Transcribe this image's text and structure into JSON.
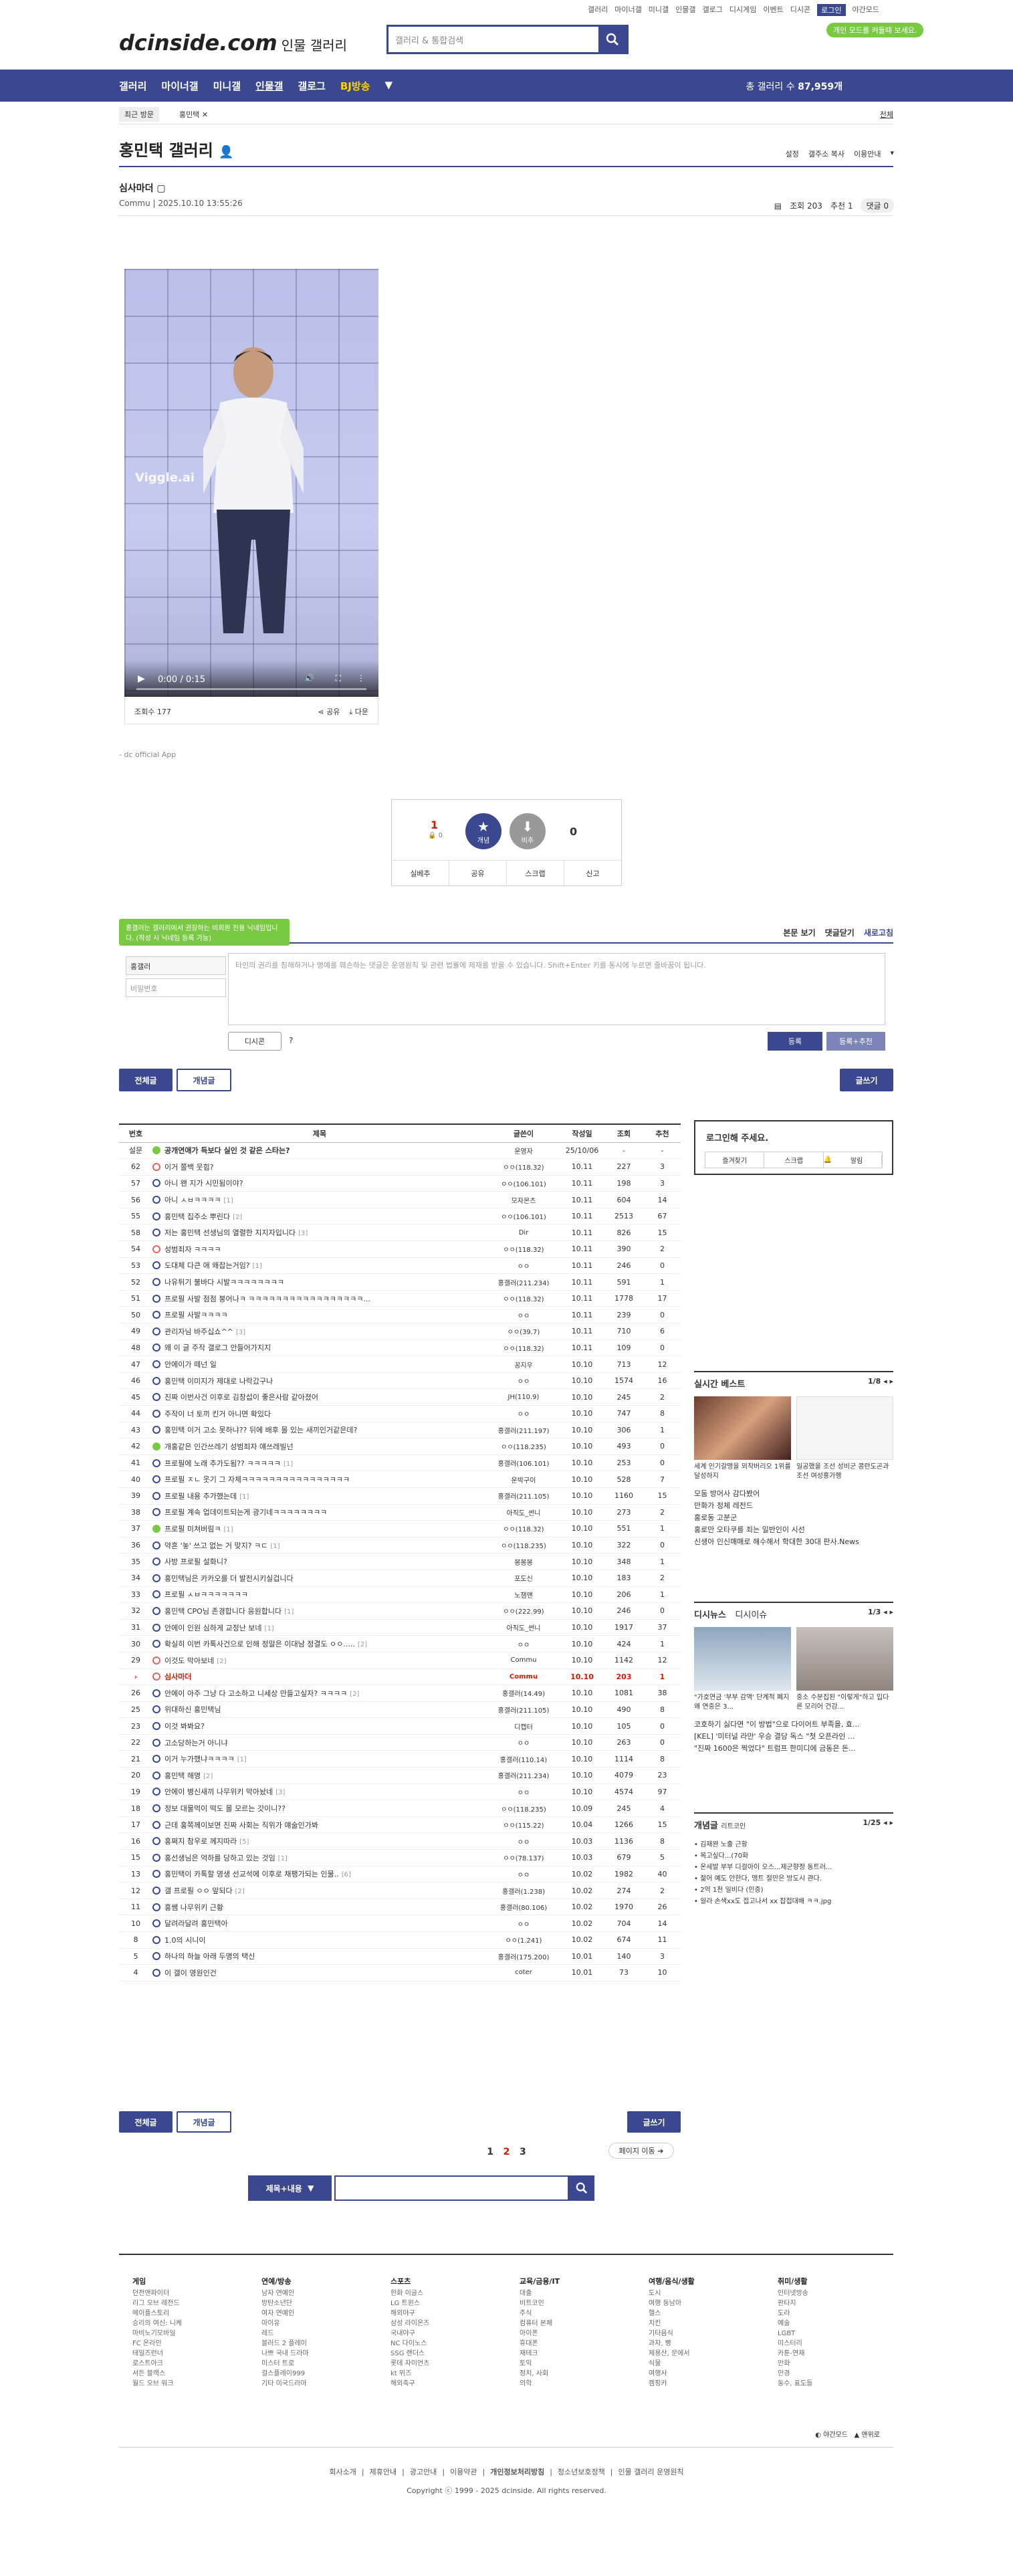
{
  "topnav": [
    "갤러리",
    "마이너갤",
    "미니갤",
    "인물갤",
    "갤로그",
    "디시게임",
    "이벤트",
    "디시콘",
    "로그인",
    "야간모드"
  ],
  "dark_badge": "개인 모드를 켜둘때 보세요.",
  "logo": "dcinside.com",
  "logo_sub": "인물 갤러리",
  "search_placeholder": "갤러리 & 통합검색",
  "gnb": {
    "items": [
      "갤러리",
      "마이너갤",
      "미니갤",
      "인물갤",
      "갤로그",
      "BJ방송"
    ],
    "total_label": "총 갤러리 수",
    "total_value": "87,959개"
  },
  "crumb": {
    "recent": "최근 방문",
    "gallery": "홍민택 ✕",
    "all": "전체"
  },
  "gallery_title": "홍민택 갤러리",
  "gallery_tools": [
    "설정",
    "갤주소 복사",
    "이용안내"
  ],
  "post": {
    "title": "심사마더",
    "author": "Commu",
    "date": "2025.10.10 13:55:26",
    "views": "조회 203",
    "recommend": "추천 1",
    "comments": "댓글 0"
  },
  "video": {
    "time": "0:00 / 0:15",
    "watermark": "Viggle.ai",
    "view_count": "조회수 177",
    "share": "공유",
    "download": "다운"
  },
  "app_note": "- dc official App",
  "recommend": {
    "up": "1",
    "up_fixed": "0",
    "rec_label": "개념",
    "non_label": "비추",
    "down": "0",
    "actions": [
      "실베추",
      "공유",
      "스크랩",
      "신고"
    ]
  },
  "comments": {
    "tip": "홍갤러는 갤러리에서 권장하는 비회원 전용 닉네임입니다. (작성 시 닉네임 등록 가능)",
    "sort": [
      "본문 보기",
      "댓글닫기",
      "새로고침"
    ],
    "id": "홍갤러",
    "pw": "비밀번호",
    "placeholder": "타인의 권리를 침해하거나 명예를 훼손하는 댓글은 운영원칙 및 관련 법률에 제재를 받을 수 있습니다. Shift+Enter 키를 동시에 누르면 줄바꿈이 됩니다.",
    "dccon": "디시콘",
    "submit": "등록",
    "submit2": "등록+추천"
  },
  "tabs": {
    "all": "전체글",
    "concept": "개념글",
    "write": "글쓰기"
  },
  "list": {
    "headers": [
      "번호",
      "제목",
      "글쓴이",
      "작성일",
      "조회",
      "추천"
    ],
    "rows": [
      {
        "no": "설문",
        "title": "공개연애가 득보다 실인 것 같은 스타는?",
        "cc": "",
        "nick": "운영자",
        "date": "25/10/06",
        "view": "-",
        "rec": "-",
        "type": "notice"
      },
      {
        "no": "62",
        "title": "이거 쫄백 웃힘?",
        "cc": "",
        "nick": "ㅇㅇ(118.32)",
        "date": "10.11",
        "view": "227",
        "rec": "3",
        "type": "pic"
      },
      {
        "no": "57",
        "title": "아니 왠 지가 시민됨이야?",
        "cc": "",
        "nick": "ㅇㅇ(106.101)",
        "date": "10.11",
        "view": "198",
        "rec": "3",
        "type": ""
      },
      {
        "no": "56",
        "title": "아니 ㅅㅂㅋㅋㅋㅋ",
        "cc": "[1]",
        "nick": "모자몬츠",
        "date": "10.11",
        "view": "604",
        "rec": "14",
        "type": ""
      },
      {
        "no": "55",
        "title": "홍민택 집주소 뿌린다",
        "cc": "[2]",
        "nick": "ㅇㅇ(106.101)",
        "date": "10.11",
        "view": "2513",
        "rec": "67",
        "type": ""
      },
      {
        "no": "58",
        "title": "저는 홍민택 선생님의 열렬한 지지자입니다",
        "cc": "[3]",
        "nick": "Dir",
        "date": "10.11",
        "view": "826",
        "rec": "15",
        "type": ""
      },
      {
        "no": "54",
        "title": "성범죄자 ㅋㅋㅋㅋ",
        "cc": "",
        "nick": "ㅇㅇ(118.32)",
        "date": "10.11",
        "view": "390",
        "rec": "2",
        "type": "pic"
      },
      {
        "no": "53",
        "title": "도대체 다큰 애 왜잡는거임?",
        "cc": "[1]",
        "nick": "ㅇㅇ",
        "date": "10.11",
        "view": "246",
        "rec": "0",
        "type": ""
      },
      {
        "no": "52",
        "title": "나유튀기 불바다 시발ㅋㅋㅋㅋㅋㅋㅋㅋ",
        "cc": "",
        "nick": "홍갤러(211.234)",
        "date": "10.11",
        "view": "591",
        "rec": "1",
        "type": ""
      },
      {
        "no": "51",
        "title": "프로필 사발 점점 붕어나ㅋ ㅋㅋㅋㅋㅋㅋㅋㅋㅋㅋㅋㅋㅋㅋㅋㅋㅋ...",
        "cc": "",
        "nick": "ㅇㅇ(118.32)",
        "date": "10.11",
        "view": "1778",
        "rec": "17",
        "type": ""
      },
      {
        "no": "50",
        "title": "프로필 사발ㅋㅋㅋㅋ",
        "cc": "",
        "nick": "ㅇㅇ",
        "date": "10.11",
        "view": "239",
        "rec": "0",
        "type": ""
      },
      {
        "no": "49",
        "title": "관리자님 바주십쇼^^",
        "cc": "[3]",
        "nick": "ㅇㅇ(39.7)",
        "date": "10.11",
        "view": "710",
        "rec": "6",
        "type": ""
      },
      {
        "no": "48",
        "title": "왜 이 글 주작 갤로그 안들어가지지",
        "cc": "",
        "nick": "ㅇㅇ(118.32)",
        "date": "10.11",
        "view": "109",
        "rec": "0",
        "type": ""
      },
      {
        "no": "47",
        "title": "안에이가 떼넌 일",
        "cc": "",
        "nick": "꽁지우",
        "date": "10.10",
        "view": "713",
        "rec": "12",
        "type": ""
      },
      {
        "no": "46",
        "title": "홍민택 이미지가 제대로 나락갔구나",
        "cc": "",
        "nick": "ㅇㅇ",
        "date": "10.10",
        "view": "1574",
        "rec": "16",
        "type": ""
      },
      {
        "no": "45",
        "title": "진짜 이번사건 이후로 김창섭이 좋은사람 같아졌어",
        "cc": "",
        "nick": "JH(110.9)",
        "date": "10.10",
        "view": "245",
        "rec": "2",
        "type": ""
      },
      {
        "no": "44",
        "title": "주작이 너 토끼 킨거 아니면 확있다",
        "cc": "",
        "nick": "ㅇㅇ",
        "date": "10.10",
        "view": "747",
        "rec": "8",
        "type": ""
      },
      {
        "no": "43",
        "title": "홍민택 이거 고소 못하냐?? 뒤에 배후 몰 있는 새끼인거같은데?",
        "cc": "",
        "nick": "홍갤러(211.197)",
        "date": "10.10",
        "view": "306",
        "rec": "1",
        "type": ""
      },
      {
        "no": "42",
        "title": "개홍같은 인간쓰레기 성범죄자 얘쓰레빌넌",
        "cc": "",
        "nick": "ㅇㅇ(118.235)",
        "date": "10.10",
        "view": "493",
        "rec": "0",
        "type": "notice"
      },
      {
        "no": "41",
        "title": "프로필에 노래 추가도됨?? ㅋㅋㅋㅋㅋ",
        "cc": "[1]",
        "nick": "홍갤러(106.101)",
        "date": "10.10",
        "view": "253",
        "rec": "0",
        "type": ""
      },
      {
        "no": "40",
        "title": "프로필 ㅈㄴ 웃기 그 자체ㅋㅋㅋㅋㅋㅋㅋㅋㅋㅋㅋㅋㅋㅋㅋㅋ",
        "cc": "",
        "nick": "운박구이",
        "date": "10.10",
        "view": "528",
        "rec": "7",
        "type": ""
      },
      {
        "no": "39",
        "title": "프로필 내용 추가했는데",
        "cc": "[1]",
        "nick": "홍갤러(211.105)",
        "date": "10.10",
        "view": "1160",
        "rec": "15",
        "type": ""
      },
      {
        "no": "38",
        "title": "프로필 계속 업데이트되는게 광기네ㅋㅋㅋㅋㅋㅋㅋㅋ",
        "cc": "",
        "nick": "아직도_썬니",
        "date": "10.10",
        "view": "273",
        "rec": "2",
        "type": ""
      },
      {
        "no": "37",
        "title": "프로필 미쳐버림ㅋ",
        "cc": "[1]",
        "nick": "ㅇㅇ(118.32)",
        "date": "10.10",
        "view": "551",
        "rec": "1",
        "type": "notice"
      },
      {
        "no": "36",
        "title": "약혼 '놓' 쓰고 없는 거 맞지? ㅋㄷ",
        "cc": "[1]",
        "nick": "ㅇㅇ(118.235)",
        "date": "10.10",
        "view": "322",
        "rec": "0",
        "type": ""
      },
      {
        "no": "35",
        "title": "사방 프로필 설화니?",
        "cc": "",
        "nick": "봉봉봉",
        "date": "10.10",
        "view": "348",
        "rec": "1",
        "type": ""
      },
      {
        "no": "34",
        "title": "홍민택님은 카카오를 더 발전시키실겁니다",
        "cc": "",
        "nick": "포도신",
        "date": "10.10",
        "view": "183",
        "rec": "2",
        "type": ""
      },
      {
        "no": "33",
        "title": "프로필 ㅅㅂㅋㅋㅋㅋㅋㅋㅋ",
        "cc": "",
        "nick": "노잼맨",
        "date": "10.10",
        "view": "206",
        "rec": "1",
        "type": ""
      },
      {
        "no": "32",
        "title": "홍민택 CPO님 존경합니다 응원합니다",
        "cc": "[1]",
        "nick": "ㅇㅇ(222.99)",
        "date": "10.10",
        "view": "246",
        "rec": "0",
        "type": ""
      },
      {
        "no": "31",
        "title": "안에이 인원 심하게 교정난 보네",
        "cc": "[1]",
        "nick": "아직도_썬니",
        "date": "10.10",
        "view": "1917",
        "rec": "37",
        "type": ""
      },
      {
        "no": "30",
        "title": "확실히 이번 카톡사건으로 인해 정말은 이대남 정결도 ㅇㅇ.....",
        "cc": "[2]",
        "nick": "ㅇㅇ",
        "date": "10.10",
        "view": "424",
        "rec": "1",
        "type": ""
      },
      {
        "no": "29",
        "title": "이것도 막아보네",
        "cc": "[2]",
        "nick": "Commu",
        "date": "10.10",
        "view": "1142",
        "rec": "12",
        "type": "pic"
      },
      {
        "no": "›",
        "title": "심사마더",
        "cc": "",
        "nick": "Commu",
        "date": "10.10",
        "view": "203",
        "rec": "1",
        "type": "pic",
        "cur": true
      },
      {
        "no": "26",
        "title": "안에이 아주 그냥 다 고소하고 니세상 만들고싶자? ㅋㅋㅋㅋ",
        "cc": "[2]",
        "nick": "홍갤러(14.49)",
        "date": "10.10",
        "view": "1081",
        "rec": "38",
        "type": ""
      },
      {
        "no": "25",
        "title": "위대하신 홍민택님",
        "cc": "",
        "nick": "홍갤러(211.105)",
        "date": "10.10",
        "view": "490",
        "rec": "8",
        "type": ""
      },
      {
        "no": "23",
        "title": "이것 봐봐요?",
        "cc": "",
        "nick": "디캡터",
        "date": "10.10",
        "view": "105",
        "rec": "0",
        "type": ""
      },
      {
        "no": "22",
        "title": "고소당하는거 아니냐",
        "cc": "",
        "nick": "ㅇㅇ",
        "date": "10.10",
        "view": "263",
        "rec": "0",
        "type": ""
      },
      {
        "no": "21",
        "title": "이거 누가했냐ㅋㅋㅋㅋ",
        "cc": "[1]",
        "nick": "홍갤러(110.14)",
        "date": "10.10",
        "view": "1114",
        "rec": "8",
        "type": ""
      },
      {
        "no": "20",
        "title": "홍민택 해명",
        "cc": "[2]",
        "nick": "홍갤러(211.234)",
        "date": "10.10",
        "view": "4079",
        "rec": "23",
        "type": ""
      },
      {
        "no": "19",
        "title": "안에이 병신새끼 나무위키 막아놨네",
        "cc": "[3]",
        "nick": "ㅇㅇ",
        "date": "10.10",
        "view": "4574",
        "rec": "97",
        "type": ""
      },
      {
        "no": "18",
        "title": "정보 대물먹이 떡도 몰 모르는 갓이니??",
        "cc": "",
        "nick": "ㅇㅇ(118.235)",
        "date": "10.09",
        "view": "245",
        "rec": "4",
        "type": ""
      },
      {
        "no": "17",
        "title": "근데 홍쪽께이보면 진짜 사회는 직위가 얘술인가봐",
        "cc": "",
        "nick": "ㅇㅇ(115.22)",
        "date": "10.04",
        "view": "1266",
        "rec": "15",
        "type": ""
      },
      {
        "no": "16",
        "title": "홍쩌지 참우로 께지따라",
        "cc": "[5]",
        "nick": "ㅇㅇ",
        "date": "10.03",
        "view": "1136",
        "rec": "8",
        "type": ""
      },
      {
        "no": "15",
        "title": "홍선생님은 억하를 당하고 있는 것임",
        "cc": "[1]",
        "nick": "ㅇㅇ(78.137)",
        "date": "10.03",
        "view": "679",
        "rec": "5",
        "type": ""
      },
      {
        "no": "13",
        "title": "홍민택이 카톡할 영생 선교석에 이후로 채팽가되는 인물..",
        "cc": "[6]",
        "nick": "ㅇㅇ",
        "date": "10.02",
        "view": "1982",
        "rec": "40",
        "type": ""
      },
      {
        "no": "12",
        "title": "갤 프로필 ㅇㅇ 앞되다",
        "cc": "[2]",
        "nick": "홍갤러(1.238)",
        "date": "10.02",
        "view": "274",
        "rec": "2",
        "type": ""
      },
      {
        "no": "11",
        "title": "홍쌤 나무위키 근황",
        "cc": "",
        "nick": "홍갤러(80.106)",
        "date": "10.02",
        "view": "1970",
        "rec": "26",
        "type": ""
      },
      {
        "no": "10",
        "title": "달려라달려 홍민택아",
        "cc": "",
        "nick": "ㅇㅇ",
        "date": "10.02",
        "view": "704",
        "rec": "14",
        "type": ""
      },
      {
        "no": "8",
        "title": "1.0의 시니이",
        "cc": "",
        "nick": "ㅇㅇ(1.241)",
        "date": "10.02",
        "view": "674",
        "rec": "11",
        "type": ""
      },
      {
        "no": "5",
        "title": "하나의 하늘 아래 두명의 택신",
        "cc": "",
        "nick": "홍갤러(175.200)",
        "date": "10.01",
        "view": "140",
        "rec": "3",
        "type": ""
      },
      {
        "no": "4",
        "title": "이 갤이 영원인건",
        "cc": "",
        "nick": "coter",
        "date": "10.01",
        "view": "73",
        "rec": "10",
        "type": ""
      }
    ]
  },
  "sidebar": {
    "login_title": "로그인해 주세요.",
    "login_actions": [
      "즐겨찾기",
      "스크랩",
      "알림"
    ],
    "best": {
      "title": "실시간 베스트",
      "page": "1/8",
      "thumbs": [
        "세계 인기갈맹을 뫼착버리오 1위를 달성하지",
        "일공했을 조선 성비군 콩란도곤과 조선 여성홍가행"
      ],
      "items": [
        "모둠 방어사 감다봤어",
        "만화가 정체 레전드",
        "홍로동 고분군",
        "홍로만 오타쿠를 죄는 일반인이 시선",
        "신생아 인신매매로 해수해서 학대한 30대 판사.News"
      ]
    },
    "issue": {
      "title": "디시뉴스",
      "tab": "디시이슈",
      "page": "1/3",
      "thumbs": [
        "\"가호연금 '부부 감액' 단계적 폐지 왜 연중은 3...",
        "중소 수분집된 \"이렇게\"하고 입다른 모리어 건강..."
      ],
      "items": [
        "코호하기 싫다면 \"이 방법\"으로 다이어트 부족을, 효...",
        "[KEL] '미터널 라만' 우승 결당 독스 \"첫 오픈라인 ...",
        "\"진짜 1600은 찍었다\" 트럼프 한미디에 금동은 돈...",
        "\"진짜 1600은 찍었다\" 트럼프 한미디에 금동은 돈..."
      ]
    },
    "concept": {
      "title": "개념글",
      "sub": "리트코인",
      "page": "1/25",
      "items": [
        "김재완 노출 근황",
        "목고싶다...(70화",
        "온세발 부부 디걸아이 오스...제군향정 동트러...",
        "젊어 예도 안한다, 맹트 절만은 방도시 관다.",
        "2억 1천 일비다 (인증)",
        "일라 손색xx도 접고나서 xx 잡접대배 ㅋㅋ.jpg"
      ]
    }
  },
  "pagination": [
    "1",
    "2",
    "3"
  ],
  "page_move": "페이지 이동",
  "bottom_search": {
    "select": "제목+내용"
  },
  "footer": {
    "cols": [
      {
        "title": "게임",
        "items": [
          "던전앤파이터",
          "리그 오브 레전드",
          "메이플스토리",
          "승리의 여신: 니케",
          "마비노기모바일",
          "FC 온라인",
          "테일즈런너",
          "로스트아크",
          "서든 블랙스",
          "월드 오브 워크"
        ]
      },
      {
        "title": "연예/방송",
        "items": [
          "남자 연예인",
          "방탄소년단",
          "여자 연예인",
          "아이유",
          "레드",
          "블러드 2 플레이",
          "나쁘 국내 드라마",
          "미스터 트로",
          "걸스플레이999",
          "기타 미국드라마"
        ]
      },
      {
        "title": "스포츠",
        "items": [
          "한화 이글스",
          "LG 트윈스",
          "해외야구",
          "삼성 라이온즈",
          "국내야구",
          "NC 다이노스",
          "SSG 랜더스",
          "롯데 자이언츠",
          "kt 위즈",
          "해외축구"
        ]
      },
      {
        "title": "교육/금융/IT",
        "items": [
          "대출",
          "비트코인",
          "주식",
          "컴퓨터 본체",
          "아이폰",
          "휴대폰",
          "재테크",
          "토익",
          "정치, 사회",
          "의학"
        ]
      },
      {
        "title": "여행/음식/생활",
        "items": [
          "도시",
          "여행 동남아",
          "헬스",
          "치킨",
          "기타음식",
          "과자, 빵",
          "제용산, 문에서",
          "식물",
          "여행사",
          "캠핑카"
        ]
      },
      {
        "title": "취미/생활",
        "items": [
          "인터넷방송",
          "판타지",
          "도라",
          "예술",
          "LGBT",
          "미스터리",
          "카툰-연재",
          "만화",
          "안경",
          "동수, 표도들"
        ]
      }
    ],
    "switch": [
      "야간모드",
      "맨위로"
    ],
    "links": [
      "회사소개",
      "제휴안내",
      "광고안내",
      "이용약관",
      "개인정보처리방침",
      "청소년보호정책",
      "인물 갤러리 운영원칙"
    ],
    "copyright": "Copyright ⓒ 1999 - 2025 dcinside. All rights reserved."
  }
}
